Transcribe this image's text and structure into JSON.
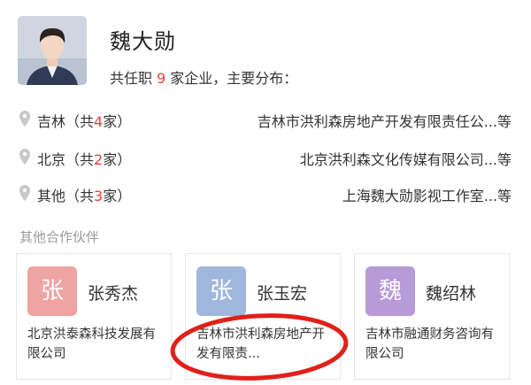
{
  "person": {
    "name": "魏大勋",
    "summary_prefix": "共任职",
    "company_count": "9",
    "summary_suffix": "家企业，主要分布："
  },
  "regions": [
    {
      "label_prefix": "吉林（共",
      "count": "4",
      "label_suffix": "家）",
      "company": "吉林市洪利森房地产开发有限责任公...等"
    },
    {
      "label_prefix": "北京（共",
      "count": "2",
      "label_suffix": "家）",
      "company": "北京洪利森文化传媒有限公司...等"
    },
    {
      "label_prefix": "其他（共",
      "count": "3",
      "label_suffix": "家）",
      "company": "上海魏大勋影视工作室...等"
    }
  ],
  "partners": {
    "title": "其他合作伙伴",
    "items": [
      {
        "initial": "张",
        "name": "张秀杰",
        "company": "北京洪泰森科技发展有限公司",
        "color": "#f0a3a3"
      },
      {
        "initial": "张",
        "name": "张玉宏",
        "company": "吉林市洪利森房地产开发有限责...",
        "color": "#9fb6dd"
      },
      {
        "initial": "魏",
        "name": "魏绍林",
        "company": "吉林市融通财务咨询有限公司",
        "color": "#b79ad8"
      }
    ]
  },
  "colors": {
    "accent": "#e8433a",
    "muted": "#999999",
    "annotation": "#e0201a",
    "pin": "#c8c8c8"
  }
}
